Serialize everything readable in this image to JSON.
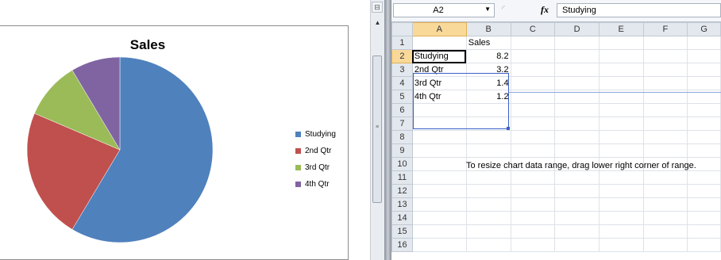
{
  "chart": {
    "title": "Sales"
  },
  "chart_data": {
    "type": "pie",
    "title": "Sales",
    "categories": [
      "Studying",
      "2nd Qtr",
      "3rd Qtr",
      "4th Qtr"
    ],
    "values": [
      8.2,
      3.2,
      1.4,
      1.2
    ],
    "colors": [
      "#4f81bd",
      "#c0504d",
      "#9bbb59",
      "#8064a2"
    ],
    "legend_placement": "right"
  },
  "formula_bar": {
    "name_box": "A2",
    "fx_label": "fx",
    "formula": "Studying"
  },
  "sheet": {
    "columns": [
      "A",
      "B",
      "C",
      "D",
      "E",
      "F",
      "G"
    ],
    "rows": [
      "1",
      "2",
      "3",
      "4",
      "5",
      "6",
      "7",
      "8",
      "9",
      "10",
      "11",
      "12",
      "13",
      "14",
      "15",
      "16"
    ],
    "header_b1": "Sales",
    "data": [
      {
        "label": "Studying",
        "value": "8.2"
      },
      {
        "label": "2nd Qtr",
        "value": "3.2"
      },
      {
        "label": "3rd Qtr",
        "value": "1.4"
      },
      {
        "label": "4th Qtr",
        "value": "1.2"
      }
    ],
    "note": "To resize chart data range, drag lower right corner of range."
  },
  "icons": {
    "name_box_dropdown": "dropdown-arrow-icon",
    "fx": "function-icon",
    "scroll_up": "scroll-up-arrow-icon"
  }
}
